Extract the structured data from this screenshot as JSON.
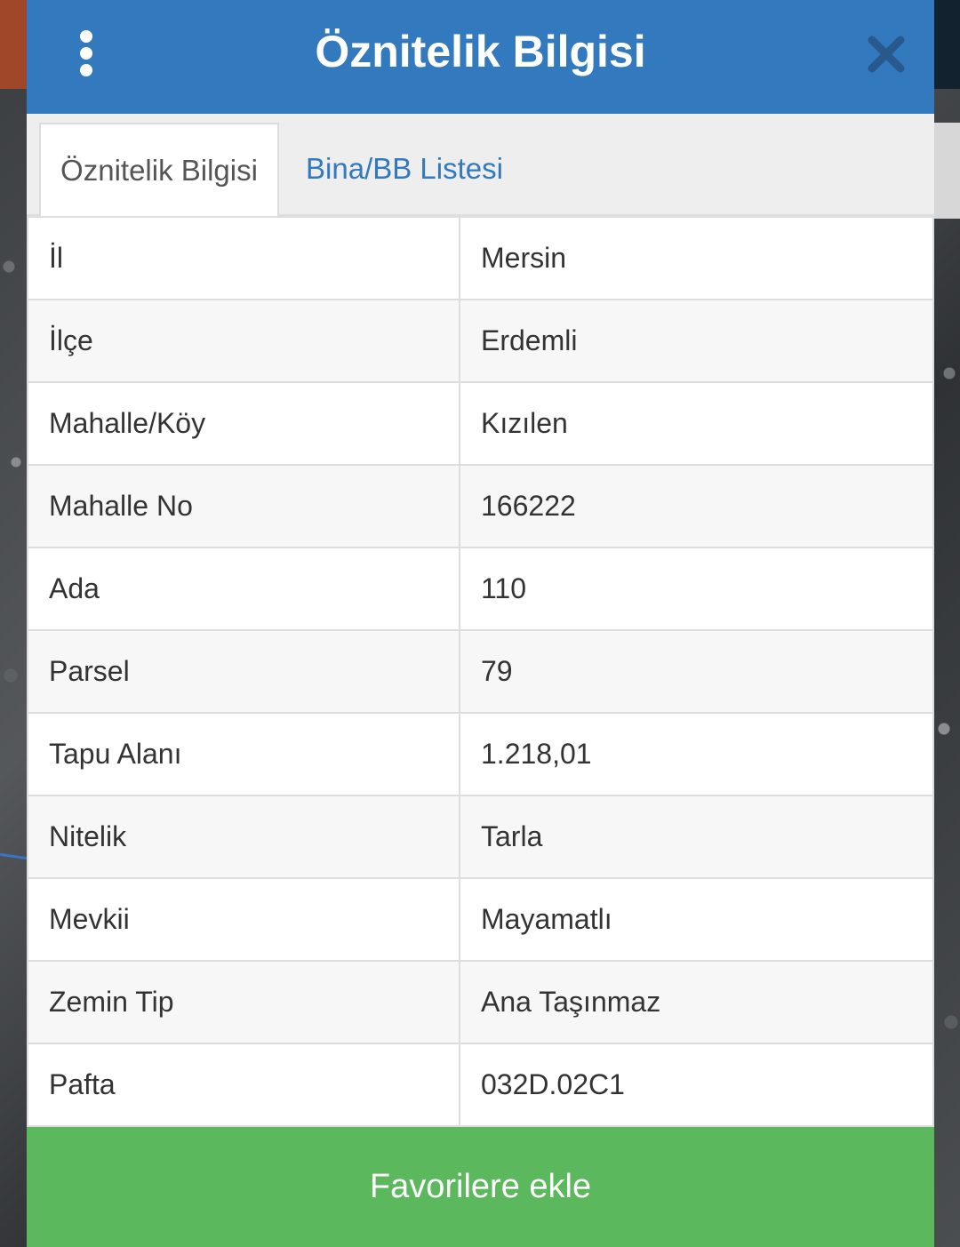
{
  "header": {
    "title": "Öznitelik Bilgisi",
    "menu_icon": "more-vertical-icon",
    "close_icon": "close-icon",
    "bg_color": "#3279bd"
  },
  "tabs": [
    {
      "label": "Öznitelik Bilgisi",
      "active": true
    },
    {
      "label": "Bina/BB Listesi",
      "active": false
    }
  ],
  "attributes": [
    {
      "key": "İl",
      "value": "Mersin"
    },
    {
      "key": "İlçe",
      "value": "Erdemli"
    },
    {
      "key": "Mahalle/Köy",
      "value": "Kızılen"
    },
    {
      "key": "Mahalle No",
      "value": "166222"
    },
    {
      "key": "Ada",
      "value": "110"
    },
    {
      "key": "Parsel",
      "value": "79"
    },
    {
      "key": "Tapu Alanı",
      "value": "1.218,01"
    },
    {
      "key": "Nitelik",
      "value": "Tarla"
    },
    {
      "key": "Mevkii",
      "value": "Mayamatlı"
    },
    {
      "key": "Zemin Tip",
      "value": "Ana Taşınmaz"
    },
    {
      "key": "Pafta",
      "value": "032D.02C1"
    }
  ],
  "footer": {
    "favorite_label": "Favorilere ekle",
    "bg_color": "#5cb85c"
  }
}
